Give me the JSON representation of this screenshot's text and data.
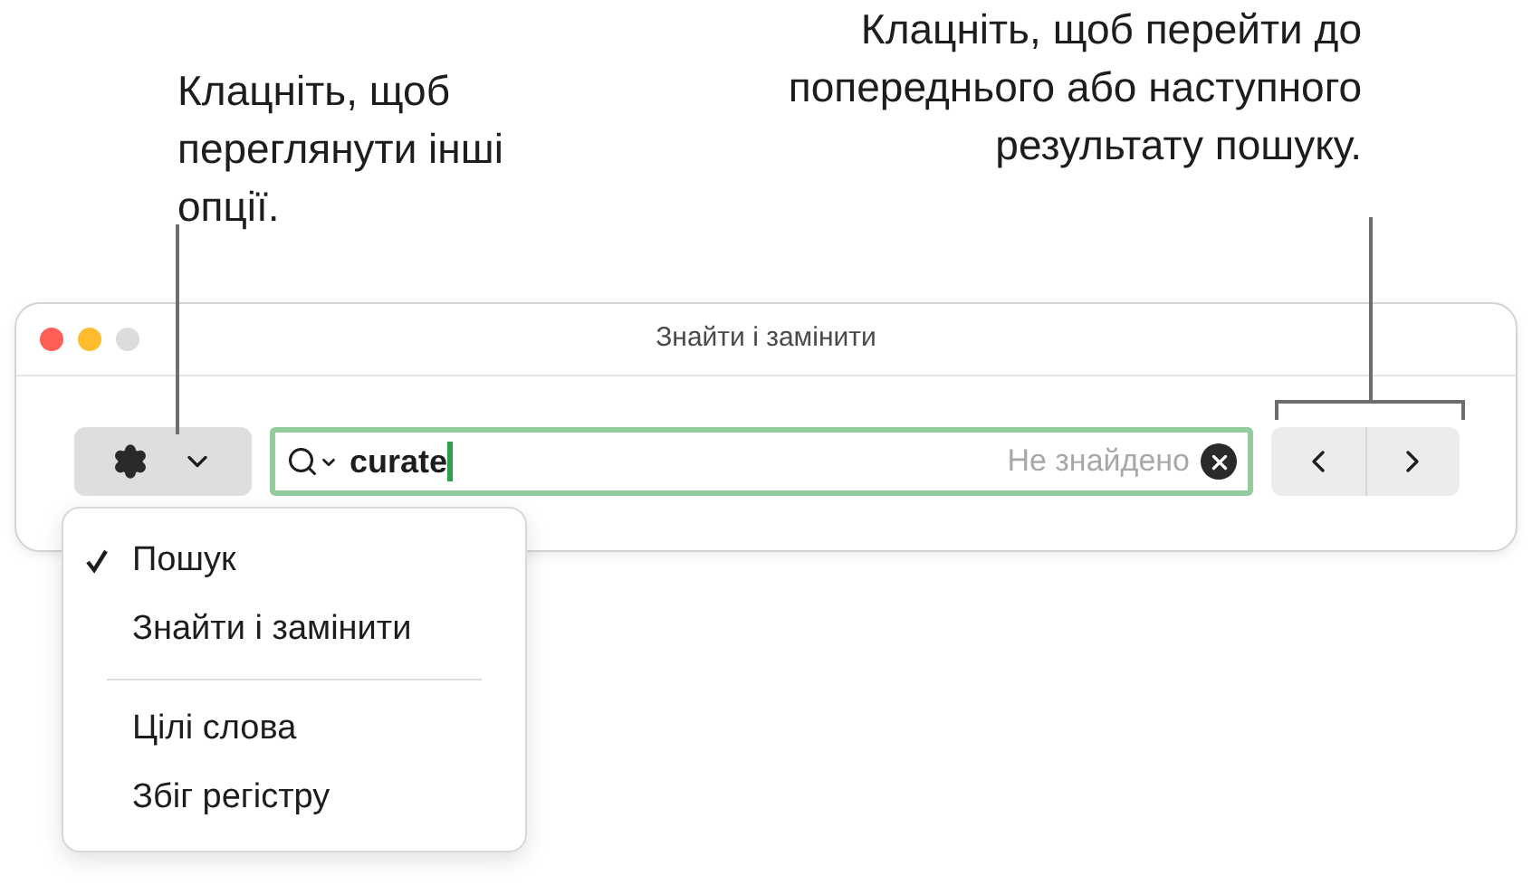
{
  "callouts": [
    {
      "text": "Клацніть, щоб переглянути інші опції."
    },
    {
      "text": "Клацніть, щоб перейти до попереднього або наступного результату пошуку."
    }
  ],
  "window": {
    "title": "Знайти і замінити"
  },
  "search": {
    "value": "curate",
    "status": "Не знайдено"
  },
  "menu": {
    "groups": [
      [
        {
          "label": "Пошук",
          "checked": true
        },
        {
          "label": "Знайти і замінити",
          "checked": false
        }
      ],
      [
        {
          "label": "Цілі слова",
          "checked": false
        },
        {
          "label": "Збіг регістру",
          "checked": false
        }
      ]
    ]
  }
}
